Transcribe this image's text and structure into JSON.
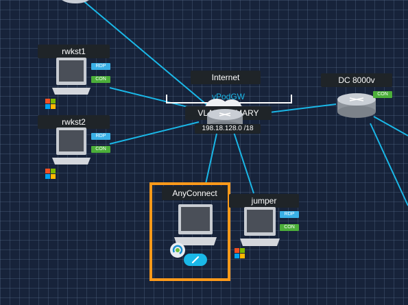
{
  "nodes": {
    "rwkst1": {
      "name": "rwkst1",
      "rdp": "RDP",
      "con": "CON",
      "os_icon": "windows-logo-icon"
    },
    "rwkst2": {
      "name": "rwkst2",
      "rdp": "RDP",
      "con": "CON",
      "os_icon": "windows-logo-icon"
    },
    "internet": {
      "name": "Internet",
      "gateway": "vPodGW"
    },
    "vlan": {
      "name": "VLAN PRIMARY",
      "subnet": "198.18.128.0 /18"
    },
    "dc8000v": {
      "name": "DC 8000v",
      "con": "CON",
      "icon": "router-icon"
    },
    "anyconnect": {
      "name": "AnyConnect",
      "icon": "anyconnect-icon",
      "action_icon": "pencil-icon"
    },
    "jumper": {
      "name": "jumper",
      "rdp": "RDP",
      "con": "CON",
      "os_icon": "windows-logo-icon"
    }
  },
  "colors": {
    "canvas": "#17233a",
    "link": "#1ab8e8",
    "selection": "#ff9a1a",
    "rdp_badge": "#3ab0e6",
    "con_badge": "#4caf3a"
  }
}
